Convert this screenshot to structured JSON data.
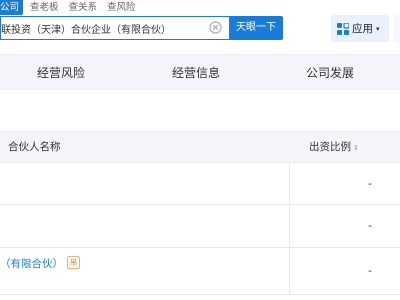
{
  "search": {
    "tabs": [
      "公司",
      "查老板",
      "查关系",
      "查风险"
    ],
    "query": "联投资（天津）合伙企业（有限合伙）",
    "button_label": "天眼一下",
    "clear_icon": "clear-circle-icon"
  },
  "apps": {
    "label": "应用",
    "icon": "app-grid-icon",
    "caret": "▾"
  },
  "nav": {
    "tabs": [
      "经营风险",
      "经营信息",
      "公司发展"
    ]
  },
  "table": {
    "headers": {
      "name": "合伙人名称",
      "ratio": "出资比例",
      "sort_glyph": "⇕"
    },
    "rows": [
      {
        "name": "",
        "ratio": "-"
      },
      {
        "name": "",
        "ratio": "-"
      },
      {
        "name": "（有限合伙）",
        "tag": "吊",
        "ratio": "-"
      }
    ]
  },
  "colors": {
    "accent": "#1a7bd8",
    "apps_bg": "#e9f2fc",
    "header_bg": "#f3f5f8",
    "tag_orange": "#f07a17"
  }
}
